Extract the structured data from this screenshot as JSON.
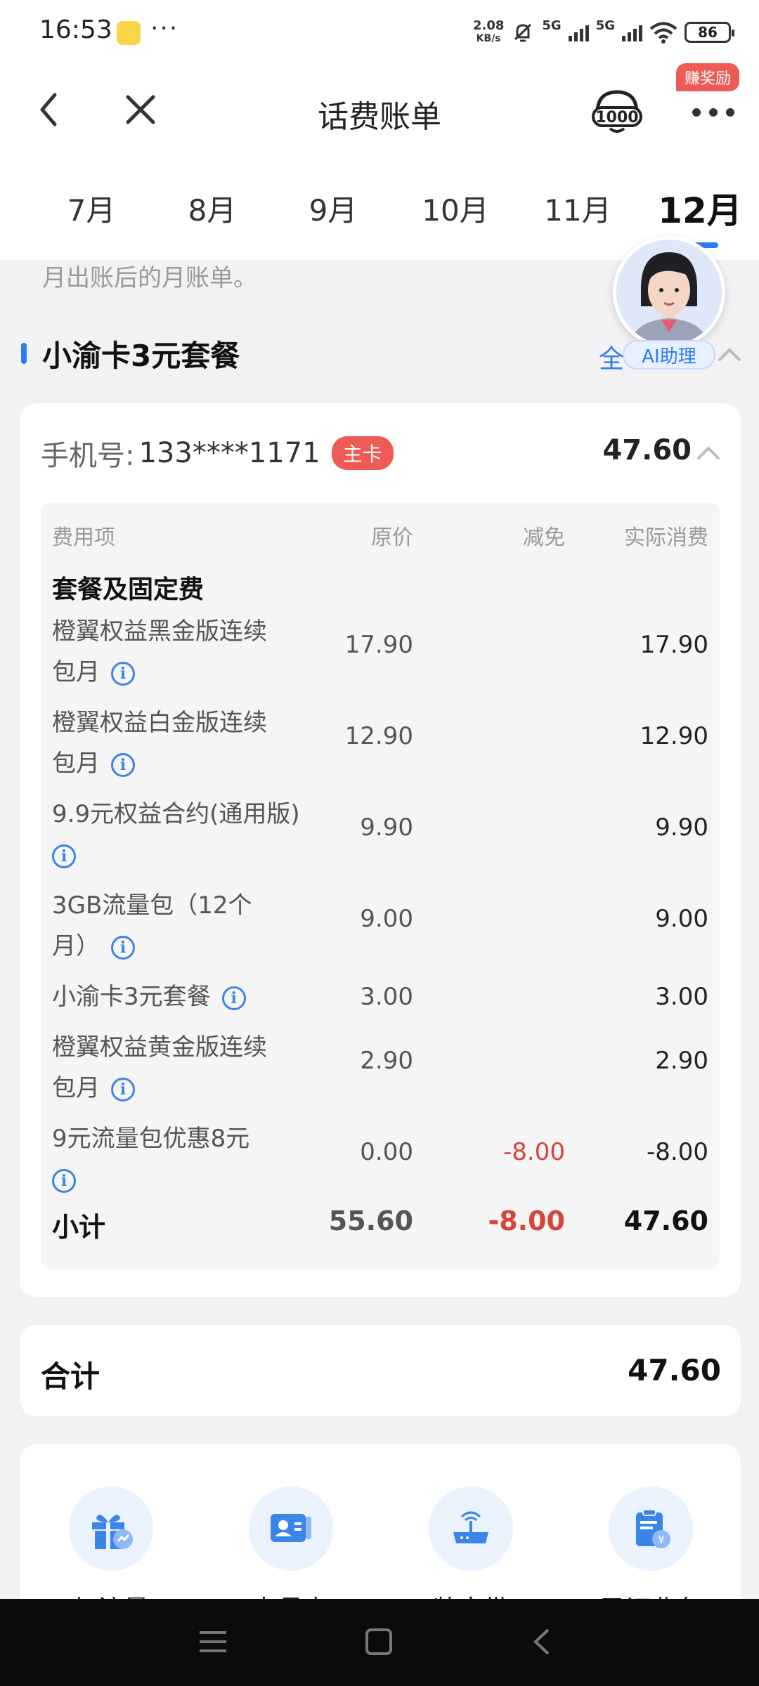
{
  "status_bar": {
    "time": "16:53",
    "dots": "···",
    "net_speed_value": "2.08",
    "net_speed_unit": "KB/s",
    "signal_label_1": "5G",
    "signal_label_2": "5G",
    "battery": "86"
  },
  "header": {
    "title": "话费账单",
    "reward_badge": "赚奖励",
    "hotline_icon": "10000-hotline-icon"
  },
  "tabs": {
    "items": [
      "7月",
      "8月",
      "9月",
      "10月",
      "11月",
      "12月"
    ],
    "active_index": 5
  },
  "notice": "月出账后的月账单。",
  "package": {
    "title": "小渝卡3元套餐",
    "collapse_all": "全",
    "ai_label": "AI助理"
  },
  "account": {
    "phone_label": "手机号:",
    "phone_number": "133****1171",
    "tag": "主卡",
    "amount": "47.60"
  },
  "bill_table": {
    "headers": [
      "费用项",
      "原价",
      "减免",
      "实际消费"
    ],
    "group": "套餐及固定费",
    "rows": [
      {
        "name_line1": "橙翼权益黑金版连续",
        "name_line2": "包月",
        "original": "17.90",
        "discount": "",
        "actual": "17.90"
      },
      {
        "name_line1": "橙翼权益白金版连续",
        "name_line2": "包月",
        "original": "12.90",
        "discount": "",
        "actual": "12.90"
      },
      {
        "name_line1": "9.9元权益合约(通用版)",
        "name_line2": "",
        "original": "9.90",
        "discount": "",
        "actual": "9.90"
      },
      {
        "name_line1": "3GB流量包（12个",
        "name_line2": "月）",
        "original": "9.00",
        "discount": "",
        "actual": "9.00"
      },
      {
        "name_line1": "小渝卡3元套餐",
        "name_line2": "",
        "original": "3.00",
        "discount": "",
        "actual": "3.00"
      },
      {
        "name_line1": "橙翼权益黄金版连续",
        "name_line2": "包月",
        "original": "2.90",
        "discount": "",
        "actual": "2.90"
      },
      {
        "name_line1": "9元流量包优惠8元",
        "name_line2": "",
        "original": "0.00",
        "discount": "-8.00",
        "actual": "-8.00"
      }
    ],
    "subtotal": {
      "label": "小计",
      "original": "55.60",
      "discount": "-8.00",
      "actual": "47.60"
    }
  },
  "total": {
    "label": "合计",
    "amount": "47.60"
  },
  "services": [
    {
      "label": "加流量",
      "icon": "gift-icon"
    },
    {
      "label": "办号卡",
      "icon": "id-card-icon"
    },
    {
      "label": "装宽带",
      "icon": "router-icon"
    },
    {
      "label": "已订业务",
      "icon": "clipboard-yuan-icon"
    }
  ],
  "colors": {
    "accent": "#2e7bf6",
    "red": "#d8433c",
    "badge": "#ee5a55"
  }
}
